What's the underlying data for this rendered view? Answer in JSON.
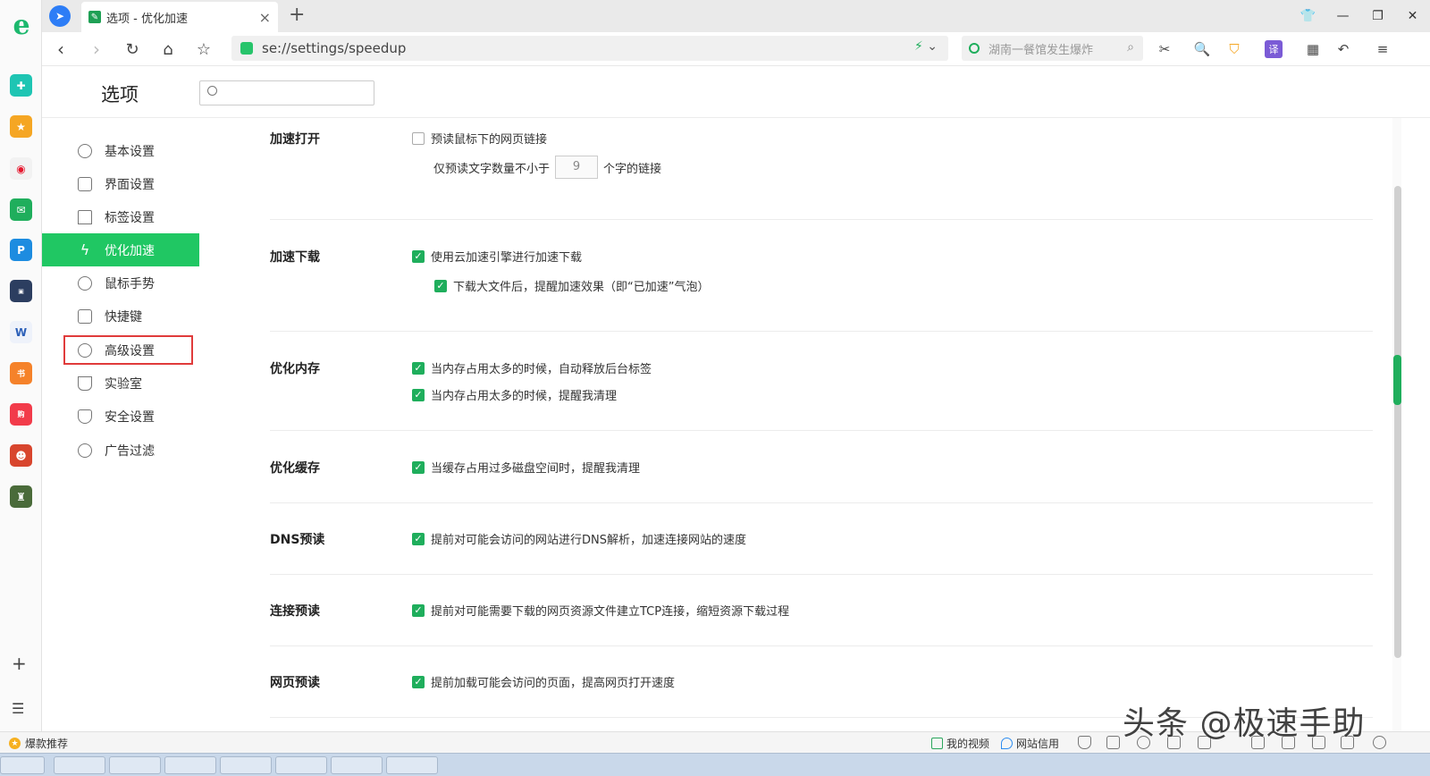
{
  "browser": {
    "tab_title": "选项 - 优化加速",
    "url": "se://settings/speedup",
    "search_placeholder": "湖南一餐馆发生爆炸"
  },
  "settings": {
    "page_title": "选项",
    "search_value": ""
  },
  "sidebar": {
    "items": [
      {
        "label": "基本设置"
      },
      {
        "label": "界面设置"
      },
      {
        "label": "标签设置"
      },
      {
        "label": "优化加速"
      },
      {
        "label": "鼠标手势"
      },
      {
        "label": "快捷键"
      },
      {
        "label": "高级设置"
      },
      {
        "label": "实验室"
      },
      {
        "label": "安全设置"
      },
      {
        "label": "广告过滤"
      }
    ]
  },
  "sections": {
    "accelerate_open": {
      "title": "加速打开",
      "opt1": "预读鼠标下的网页链接",
      "opt1_checked": false,
      "prefix": "仅预读文字数量不小于",
      "num_value": "9",
      "suffix": "个字的链接"
    },
    "accelerate_download": {
      "title": "加速下载",
      "opt1": "使用云加速引擎进行加速下载",
      "opt2": "下载大文件后，提醒加速效果（即“已加速”气泡）"
    },
    "optimize_memory": {
      "title": "优化内存",
      "opt1": "当内存占用太多的时候，自动释放后台标签",
      "opt2": "当内存占用太多的时候，提醒我清理"
    },
    "optimize_cache": {
      "title": "优化缓存",
      "opt1": "当缓存占用过多磁盘空间时，提醒我清理"
    },
    "dns_prefetch": {
      "title": "DNS预读",
      "opt1": "提前对可能会访问的网站进行DNS解析，加速连接网站的速度"
    },
    "connect_prefetch": {
      "title": "连接预读",
      "opt1": "提前对可能需要下载的网页资源文件建立TCP连接，缩短资源下载过程"
    },
    "page_prefetch": {
      "title": "网页预读",
      "opt1": "提前加载可能会访问的页面，提高网页打开速度"
    }
  },
  "statusbar": {
    "left": "爆款推荐",
    "my_video": "我的视频",
    "site_credit": "网站信用"
  },
  "watermark": "头条 @极速手助",
  "colors": {
    "accent": "#20c763",
    "checkbox": "#1fae5c",
    "highlight": "#e03b3b"
  }
}
